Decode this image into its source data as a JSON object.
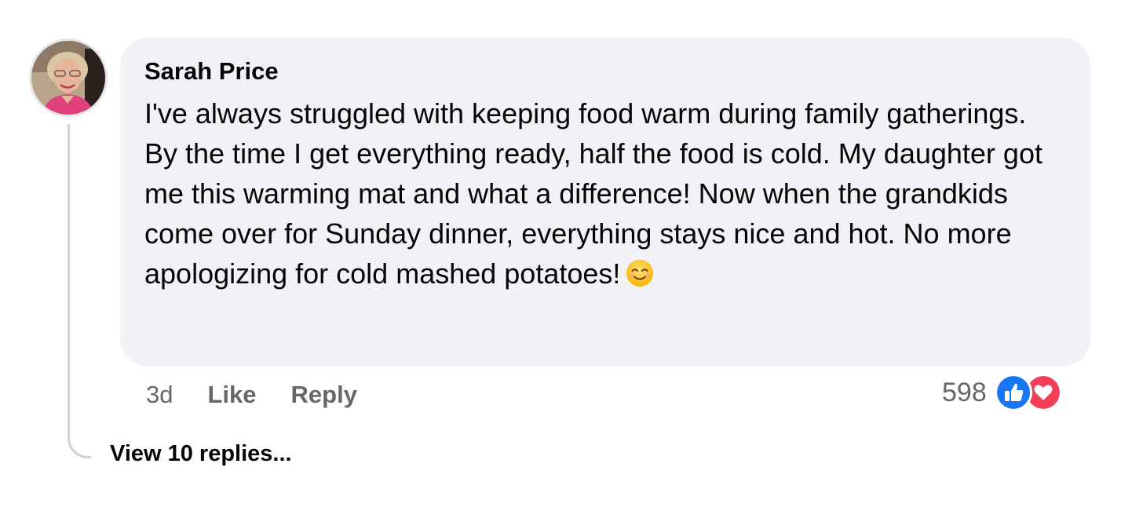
{
  "comment": {
    "author": "Sarah Price",
    "text": "I've always struggled with keeping food warm during family gatherings. By the time I get everything ready, half the food is cold. My daughter got me this warming mat and what a difference! Now when the grandkids come over for Sunday dinner, everything stays nice and hot. No more apologizing for cold mashed potatoes!",
    "emoji": "smiling-face-emoji",
    "avatar": "profile-photo"
  },
  "actions": {
    "time": "3d",
    "like_label": "Like",
    "reply_label": "Reply"
  },
  "reactions": {
    "count": "598",
    "icons": [
      "like-reaction-icon",
      "love-reaction-icon"
    ],
    "colors": {
      "like": "#1877f2",
      "love": "#f33e58"
    }
  },
  "replies": {
    "view_label": "View 10 replies..."
  },
  "colors": {
    "bubble_bg": "#f0f2f5",
    "secondary_text": "#65676b",
    "primary_text": "#050505",
    "thread_line": "#ced0d4"
  }
}
